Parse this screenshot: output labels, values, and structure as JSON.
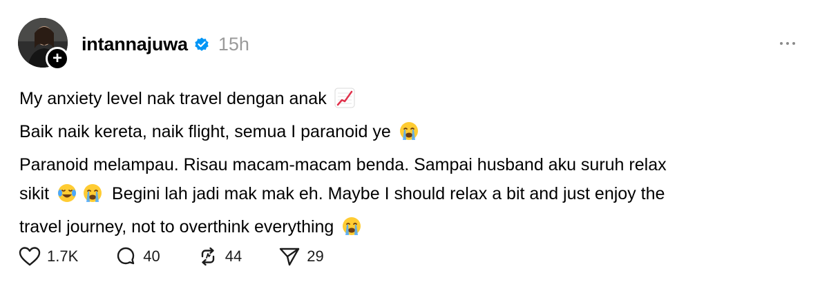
{
  "post": {
    "author": {
      "username": "intannajuwa",
      "verified_icon": "verified-badge-icon",
      "avatar_icon": "avatar-image",
      "follow_icon": "plus-icon",
      "follow_symbol": "+"
    },
    "timestamp": "15h",
    "more_icon": "more-options-icon",
    "lines": [
      {
        "text": "My anxiety level nak travel dengan anak",
        "emoji": "chart-increasing-icon"
      },
      {
        "text": "Baik naik kereta, naik flight, semua I paranoid ye",
        "emoji": "loudly-crying-face-icon"
      },
      {
        "text": "Paranoid melampau. Risau macam-macam benda. Sampai husband aku suruh relax",
        "emoji": ""
      },
      {
        "text_before": "sikit",
        "text_after": "Begini lah jadi mak mak eh. Maybe I should relax a bit and just enjoy the",
        "emoji": [
          "face-with-tears-of-joy-icon",
          "loudly-crying-face-icon"
        ]
      },
      {
        "text": "travel journey, not to overthink everything",
        "emoji": "loudly-crying-face-icon"
      }
    ],
    "actions": {
      "like": {
        "icon": "heart-icon",
        "count": "1.7K"
      },
      "reply": {
        "icon": "comment-icon",
        "count": "40"
      },
      "repost": {
        "icon": "repost-icon",
        "count": "44"
      },
      "share": {
        "icon": "send-icon",
        "count": "29"
      }
    },
    "colors": {
      "text": "#000000",
      "muted": "#9a9a9a",
      "verified": "#0095f6",
      "chart_emoji": "#e0314b",
      "emoji_face": "#ffcc33",
      "tears": "#4aa8ff"
    }
  }
}
